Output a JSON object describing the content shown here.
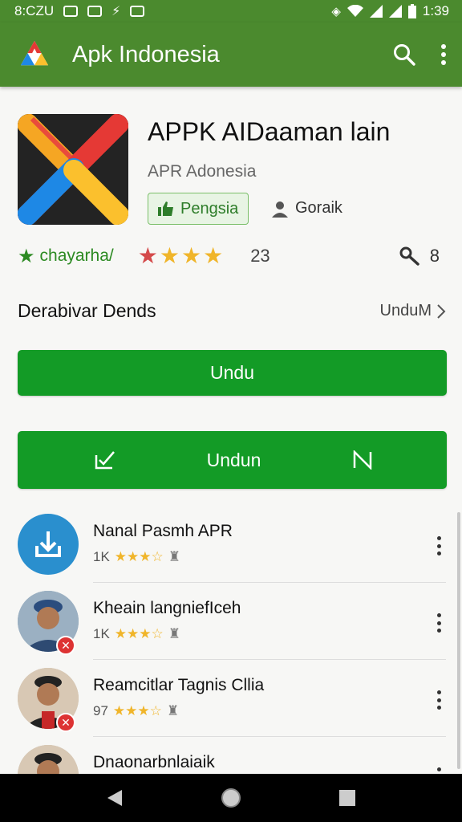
{
  "status_bar": {
    "left_text": "8:CZU",
    "time": "1:39"
  },
  "app_bar": {
    "title": "Apk Indonesia",
    "logo_icon": "triangle-logo-icon",
    "actions": [
      "search-icon",
      "more-vert-icon"
    ]
  },
  "app": {
    "name": "APPK AIDaaman lain",
    "developer": "APR Adonesia",
    "category": "Pengsia",
    "author": "Goraik",
    "tag": "chayarha/",
    "stars": "★★★★",
    "rating_count": "23",
    "key_value": "8"
  },
  "section": {
    "title": "Derabivar Dends",
    "more_label": "UnduM"
  },
  "buttons": {
    "primary_label": "Undu",
    "secondary_label": "Undun"
  },
  "list": [
    {
      "title": "Nanal Pasmh APR",
      "count": "1K",
      "stars": "★★★☆",
      "avatar": "download-icon"
    },
    {
      "title": "Kheain langniefIceh",
      "count": "1K",
      "stars": "★★★☆",
      "avatar": "person-avatar"
    },
    {
      "title": "Reamcitlar Tagnis Cllia",
      "count": "97",
      "stars": "★★★☆",
      "avatar": "person-avatar"
    },
    {
      "title": "Dnaonarbnlaiaik",
      "count": "",
      "stars": "",
      "avatar": "person-avatar"
    }
  ],
  "colors": {
    "app_bar": "#4b8a2e",
    "button": "#139b26",
    "star_gold": "#f0b52a",
    "star_red": "#d44a4a",
    "tag_green": "#2c8a22"
  }
}
